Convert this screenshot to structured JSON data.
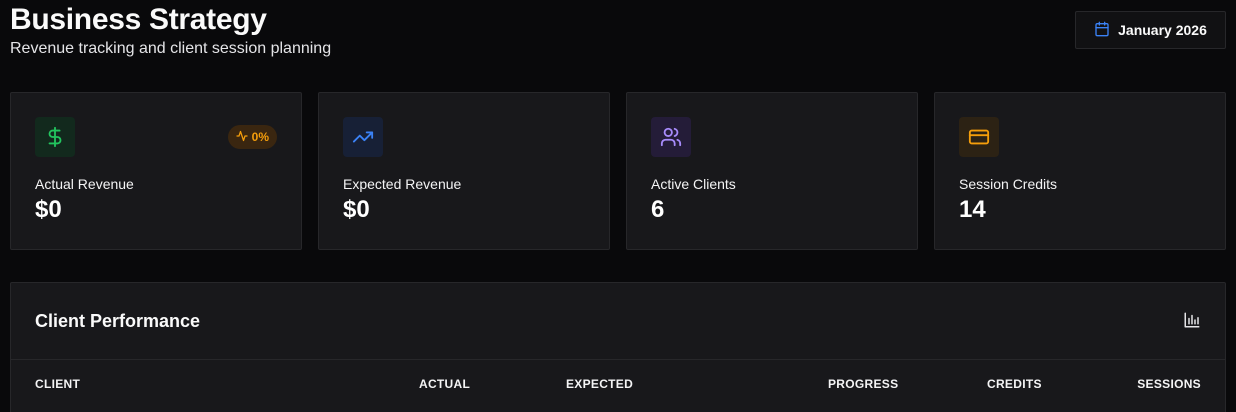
{
  "header": {
    "title": "Business Strategy",
    "subtitle": "Revenue tracking and client session planning",
    "date_label": "January 2026"
  },
  "cards": [
    {
      "label": "Actual Revenue",
      "value": "$0",
      "icon": "dollar-icon",
      "accent": "#22c55e",
      "badge": "0%"
    },
    {
      "label": "Expected Revenue",
      "value": "$0",
      "icon": "trending-up-icon",
      "accent": "#3b82f6"
    },
    {
      "label": "Active Clients",
      "value": "6",
      "icon": "users-icon",
      "accent": "#a78bfa"
    },
    {
      "label": "Session Credits",
      "value": "14",
      "icon": "credit-card-icon",
      "accent": "#f59e0b"
    }
  ],
  "performance": {
    "title": "Client Performance",
    "icon": "bar-chart-icon",
    "columns": [
      "CLIENT",
      "ACTUAL",
      "EXPECTED",
      "PROGRESS",
      "CREDITS",
      "SESSIONS"
    ]
  }
}
